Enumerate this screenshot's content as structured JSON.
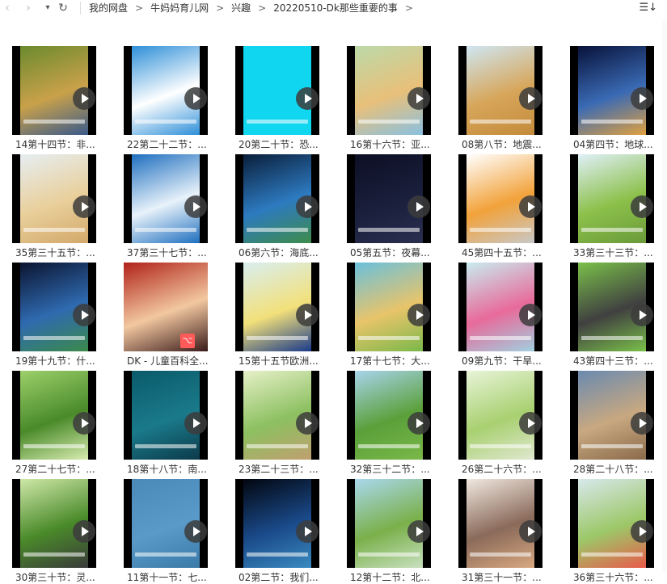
{
  "toolbar": {
    "back_icon": "chevron-left-icon",
    "forward_icon": "chevron-right-icon",
    "history_icon": "caret-down-icon",
    "refresh_icon": "refresh-icon",
    "sort_icon": "sort-list-icon"
  },
  "breadcrumb": [
    "我的网盘",
    "牛妈妈育儿网",
    "兴趣",
    "20220510-Dk那些重要的事"
  ],
  "files": [
    {
      "name": "14第十四节：非...",
      "type": "video",
      "colors": [
        "#6b8a2e",
        "#c9a14a",
        "#3a5a8a"
      ]
    },
    {
      "name": "22第二十二节：...",
      "type": "video",
      "colors": [
        "#2e8fd8",
        "#ffffff",
        "#2e8fd8"
      ]
    },
    {
      "name": "20第二十节：恐...",
      "type": "video",
      "colors": [
        "#10d6f0",
        "#10d6f0",
        "#10d6f0"
      ]
    },
    {
      "name": "16第十六节：亚...",
      "type": "video",
      "colors": [
        "#bcd9a8",
        "#e8c07a",
        "#89c0e0"
      ]
    },
    {
      "name": "08第八节：地震...",
      "type": "video",
      "colors": [
        "#cfe6f2",
        "#d7a65a",
        "#c48a3a"
      ]
    },
    {
      "name": "04第四节：地球...",
      "type": "video",
      "colors": [
        "#08123a",
        "#3a6ab4",
        "#e1a040"
      ]
    },
    {
      "name": "35第三十五节：...",
      "type": "video",
      "colors": [
        "#e6eef2",
        "#e9cf9a",
        "#d2a86a"
      ]
    },
    {
      "name": "37第三十七节：...",
      "type": "video",
      "colors": [
        "#1f6fbf",
        "#e8f2fa",
        "#1f6fbf"
      ]
    },
    {
      "name": "06第六节：海底...",
      "type": "video",
      "colors": [
        "#0a1e3a",
        "#2d7ac0",
        "#3e8c4a"
      ]
    },
    {
      "name": "05第五节：夜幕...",
      "type": "video",
      "colors": [
        "#0c0f24",
        "#1a1f3c",
        "#2a2f50"
      ]
    },
    {
      "name": "45第四十五节：...",
      "type": "video",
      "colors": [
        "#ffffff",
        "#f2a23a",
        "#c8c8c8"
      ]
    },
    {
      "name": "33第三十三节：...",
      "type": "video",
      "colors": [
        "#dff0f8",
        "#8cc04a",
        "#6a9a3a"
      ]
    },
    {
      "name": "19第十九节：什...",
      "type": "video",
      "colors": [
        "#0b1430",
        "#2f6ab0",
        "#3b8a4a"
      ]
    },
    {
      "name": "DK - 儿童百科全...",
      "type": "pdf",
      "colors": [
        "#b0221a",
        "#f2c8a0",
        "#3a1a1a"
      ]
    },
    {
      "name": "15第十五节欧洲...",
      "type": "video",
      "colors": [
        "#d8eef0",
        "#f2e07a",
        "#1a3a8a"
      ]
    },
    {
      "name": "17第十七节：大...",
      "type": "video",
      "colors": [
        "#6ac0dc",
        "#e8c46a",
        "#7ab84a"
      ]
    },
    {
      "name": "09第九节：干旱...",
      "type": "video",
      "colors": [
        "#c8ecf0",
        "#e86a9a",
        "#a0d0e0"
      ]
    },
    {
      "name": "43第四十三节：...",
      "type": "video",
      "colors": [
        "#7ac04a",
        "#404040",
        "#7ac04a"
      ]
    },
    {
      "name": "27第二十七节：...",
      "type": "video",
      "colors": [
        "#9cd06a",
        "#4a8a2a",
        "#d8ecb0"
      ]
    },
    {
      "name": "18第十八节：南...",
      "type": "video",
      "colors": [
        "#0a5a6a",
        "#1a7a8a",
        "#0c3a4a"
      ]
    },
    {
      "name": "23第二十三节：...",
      "type": "video",
      "colors": [
        "#e6f0c8",
        "#8cc060",
        "#c0a070"
      ]
    },
    {
      "name": "32第三十二节：...",
      "type": "video",
      "colors": [
        "#a8d4ec",
        "#5aa03a",
        "#7ab848"
      ]
    },
    {
      "name": "26第二十六节：...",
      "type": "video",
      "colors": [
        "#e8f4d8",
        "#a8d070",
        "#e0e8d0"
      ]
    },
    {
      "name": "28第二十八节：...",
      "type": "video",
      "colors": [
        "#6a8ab0",
        "#c8a880",
        "#8a6a4a"
      ]
    },
    {
      "name": "30第三十节：灵...",
      "type": "video",
      "colors": [
        "#cfe8a8",
        "#4a8a2a",
        "#3a3a3a"
      ]
    },
    {
      "name": "11第十一节：七...",
      "type": "video",
      "colors": [
        "#4a8ab8",
        "#5a9ac8",
        "#3a7aa8"
      ]
    },
    {
      "name": "02第二节：我们...",
      "type": "video",
      "colors": [
        "#02060f",
        "#1a4a8a",
        "#3a8ac0"
      ]
    },
    {
      "name": "12第十二节：北...",
      "type": "video",
      "colors": [
        "#aad8ee",
        "#7ab04a",
        "#c8e0c0"
      ]
    },
    {
      "name": "31第三十一节：...",
      "type": "video",
      "colors": [
        "#f0e8e0",
        "#8a6a5a",
        "#d8a880"
      ]
    },
    {
      "name": "36第三十六节：...",
      "type": "video",
      "colors": [
        "#d8e8ec",
        "#9cc868",
        "#e85a4a"
      ]
    }
  ]
}
